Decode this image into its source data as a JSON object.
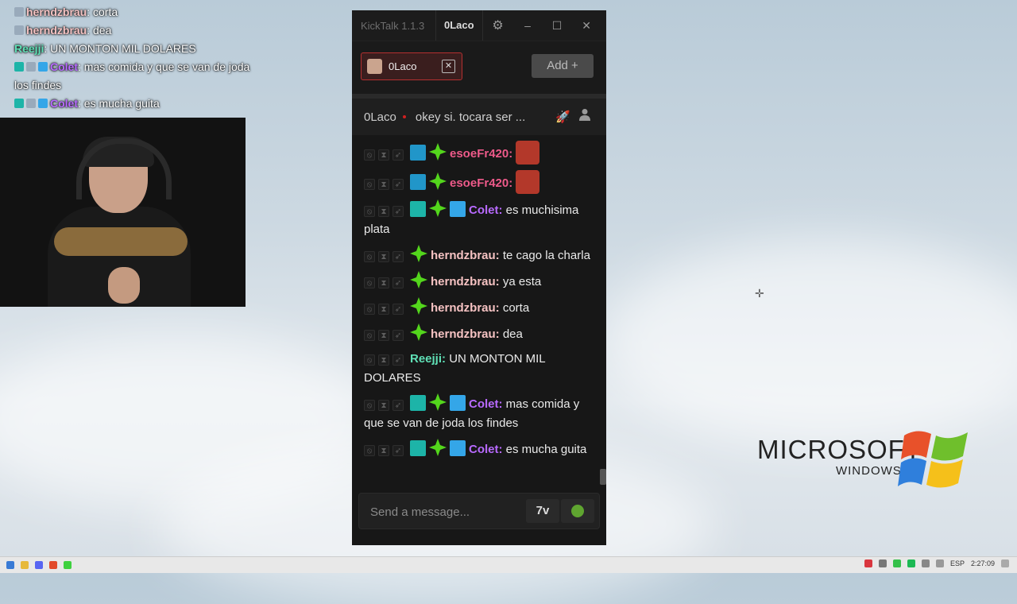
{
  "overlay_chat": [
    {
      "user": "herndzbrau",
      "user_color": "#f5c2c2",
      "text": "corta",
      "badges": [
        "sub"
      ]
    },
    {
      "user": "herndzbrau",
      "user_color": "#f5c2c2",
      "text": "dea",
      "badges": [
        "sub"
      ]
    },
    {
      "user": "Reejji",
      "user_color": "#5fe0b6",
      "text": "UN MONTON MIL DOLARES",
      "badges": []
    },
    {
      "user": "Colet",
      "user_color": "#b86aff",
      "text": "mas comida y que se van de joda los findes",
      "badges": [
        "og",
        "sub",
        "cube"
      ]
    },
    {
      "user": "Colet",
      "user_color": "#b86aff",
      "text": "es mucha guita",
      "badges": [
        "og",
        "sub",
        "cube"
      ]
    }
  ],
  "window": {
    "app_title": "KickTalk 1.1.3",
    "user": "0Laco",
    "settings_icon": "gear-icon",
    "minimize": "–",
    "maximize": "☐",
    "close": "✕"
  },
  "tabs": {
    "active": {
      "label": "0Laco",
      "close": "✕"
    },
    "add_label": "Add +"
  },
  "stream": {
    "name": "0Laco",
    "title": "okey si. tocara ser ...",
    "live_color": "#d02020"
  },
  "messages": [
    {
      "user": "esoeFr420:",
      "color": "#ee5a8a",
      "text": "",
      "badges": [
        "mod",
        "sub"
      ],
      "emote": true
    },
    {
      "user": "esoeFr420:",
      "color": "#ee5a8a",
      "text": "",
      "badges": [
        "mod",
        "sub"
      ],
      "emote": true
    },
    {
      "user": "Colet:",
      "color": "#b86aff",
      "text": "es muchisima plata",
      "badges": [
        "og",
        "sub",
        "cube"
      ]
    },
    {
      "user": "herndzbrau:",
      "color": "#f5c2c2",
      "text": "te cago la charla",
      "badges": [
        "sub"
      ]
    },
    {
      "user": "herndzbrau:",
      "color": "#f5c2c2",
      "text": "ya esta",
      "badges": [
        "sub"
      ]
    },
    {
      "user": "herndzbrau:",
      "color": "#f5c2c2",
      "text": "corta",
      "badges": [
        "sub"
      ]
    },
    {
      "user": "herndzbrau:",
      "color": "#f5c2c2",
      "text": "dea",
      "badges": [
        "sub"
      ]
    },
    {
      "user": "Reejji:",
      "color": "#5fe0b6",
      "text": "UN MONTON MIL DOLARES",
      "badges": []
    },
    {
      "user": "Colet:",
      "color": "#b86aff",
      "text": "mas comida y que se van de joda los findes",
      "badges": [
        "og",
        "sub",
        "cube"
      ]
    },
    {
      "user": "Colet:",
      "color": "#b86aff",
      "text": "es mucha guita",
      "badges": [
        "og",
        "sub",
        "cube"
      ]
    }
  ],
  "input": {
    "placeholder": "Send a message...",
    "btn_7tv": "7v"
  },
  "desktop": {
    "xp_brand": "MICROSOFT",
    "xp_sub": "WINDOWS XP"
  },
  "taskbar": {
    "lang": "ESP",
    "time": "2:27:09"
  }
}
